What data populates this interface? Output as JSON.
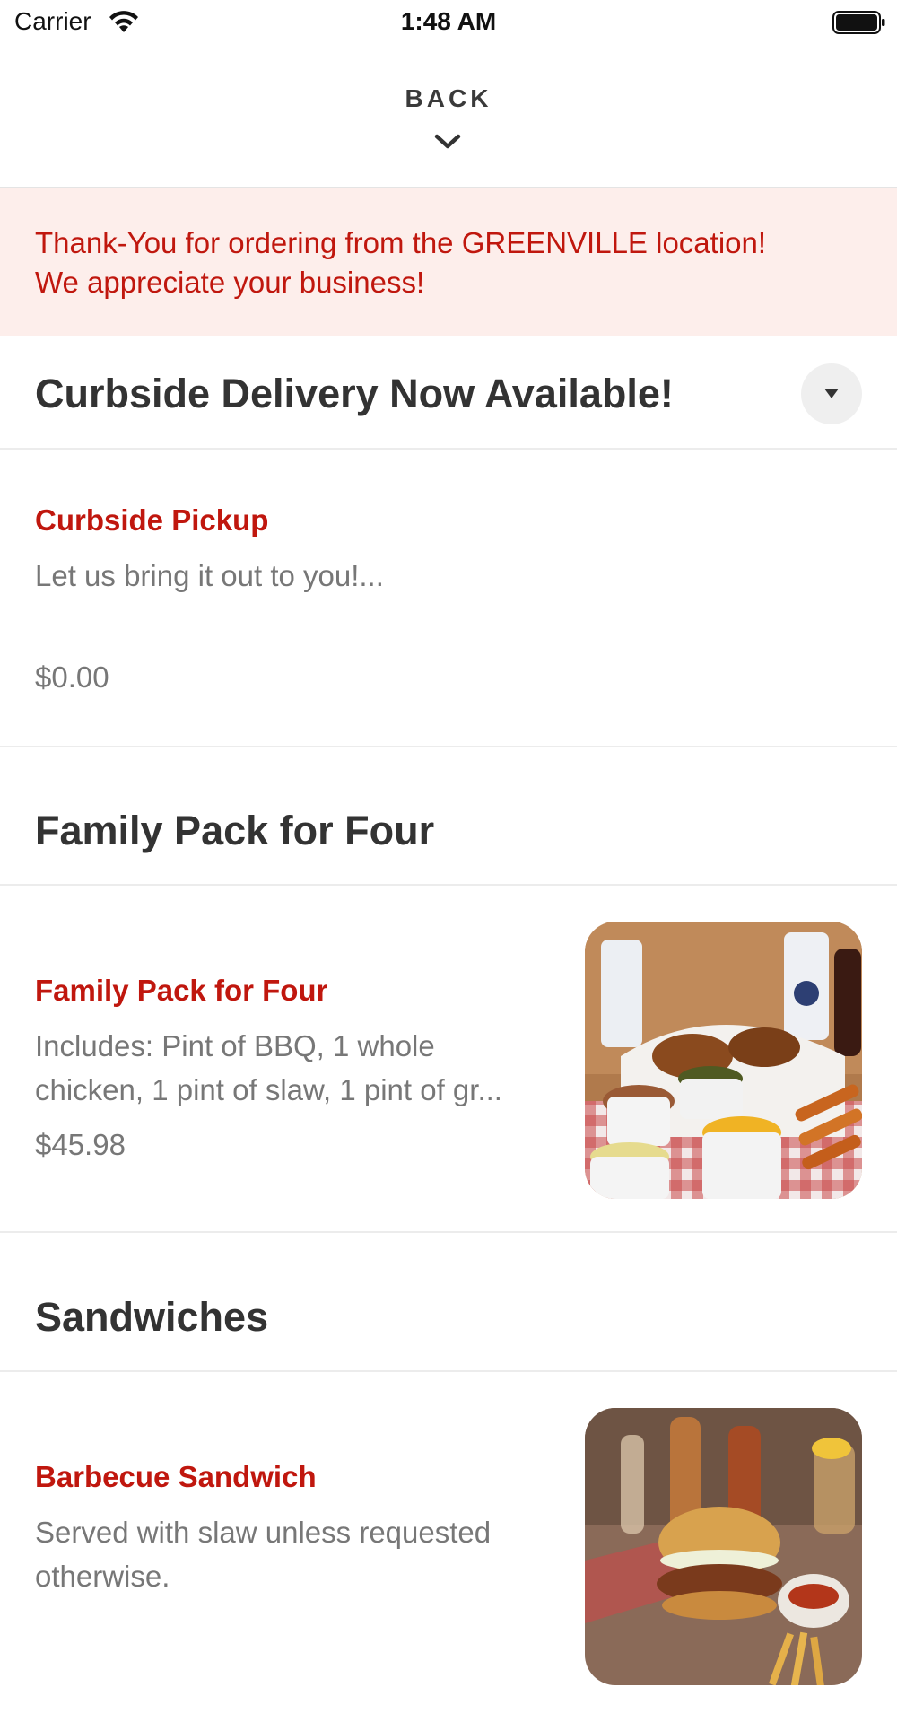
{
  "status_bar": {
    "carrier": "Carrier",
    "time": "1:48 AM",
    "icons": [
      "wifi-icon",
      "battery-icon"
    ]
  },
  "header": {
    "back_label": "BACK",
    "icon": "chevron-down-icon"
  },
  "notice": {
    "line1": "Thank-You for ordering from the GREENVILLE location!",
    "line2": "We appreciate your business!"
  },
  "colors": {
    "accent": "#c0170e",
    "notice_bg": "#fdeeeb",
    "heading": "#333333",
    "muted": "#777777"
  },
  "sections": [
    {
      "title": "Curbside Delivery Now Available!",
      "items": [
        {
          "name": "Curbside Pickup",
          "description": "Let us bring it out to you!...",
          "price": "$0.00"
        }
      ]
    },
    {
      "title": "Family Pack for Four",
      "items": [
        {
          "name": "Family Pack for Four",
          "description_line1": "Includes: Pint of BBQ, 1 whole",
          "description_line2": "chicken, 1 pint of slaw, 1 pint of gr...",
          "price": "$45.98"
        }
      ]
    },
    {
      "title": "Sandwiches",
      "items": [
        {
          "name": "Barbecue Sandwich",
          "description_line1": "Served with slaw unless requested",
          "description_line2": "otherwise."
        }
      ]
    }
  ]
}
